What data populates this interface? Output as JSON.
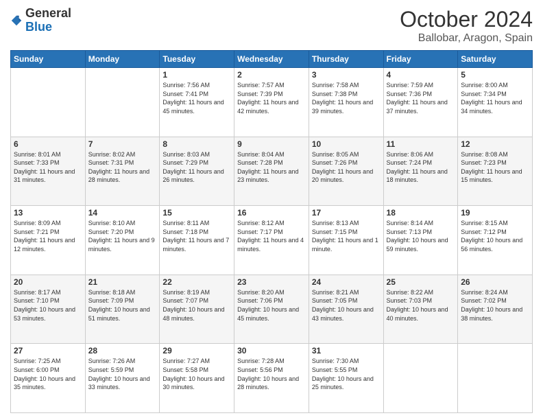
{
  "header": {
    "logo_general": "General",
    "logo_blue": "Blue",
    "month_title": "October 2024",
    "subtitle": "Ballobar, Aragon, Spain"
  },
  "days_of_week": [
    "Sunday",
    "Monday",
    "Tuesday",
    "Wednesday",
    "Thursday",
    "Friday",
    "Saturday"
  ],
  "weeks": [
    [
      {
        "day": "",
        "sunrise": "",
        "sunset": "",
        "daylight": ""
      },
      {
        "day": "",
        "sunrise": "",
        "sunset": "",
        "daylight": ""
      },
      {
        "day": "1",
        "sunrise": "Sunrise: 7:56 AM",
        "sunset": "Sunset: 7:41 PM",
        "daylight": "Daylight: 11 hours and 45 minutes."
      },
      {
        "day": "2",
        "sunrise": "Sunrise: 7:57 AM",
        "sunset": "Sunset: 7:39 PM",
        "daylight": "Daylight: 11 hours and 42 minutes."
      },
      {
        "day": "3",
        "sunrise": "Sunrise: 7:58 AM",
        "sunset": "Sunset: 7:38 PM",
        "daylight": "Daylight: 11 hours and 39 minutes."
      },
      {
        "day": "4",
        "sunrise": "Sunrise: 7:59 AM",
        "sunset": "Sunset: 7:36 PM",
        "daylight": "Daylight: 11 hours and 37 minutes."
      },
      {
        "day": "5",
        "sunrise": "Sunrise: 8:00 AM",
        "sunset": "Sunset: 7:34 PM",
        "daylight": "Daylight: 11 hours and 34 minutes."
      }
    ],
    [
      {
        "day": "6",
        "sunrise": "Sunrise: 8:01 AM",
        "sunset": "Sunset: 7:33 PM",
        "daylight": "Daylight: 11 hours and 31 minutes."
      },
      {
        "day": "7",
        "sunrise": "Sunrise: 8:02 AM",
        "sunset": "Sunset: 7:31 PM",
        "daylight": "Daylight: 11 hours and 28 minutes."
      },
      {
        "day": "8",
        "sunrise": "Sunrise: 8:03 AM",
        "sunset": "Sunset: 7:29 PM",
        "daylight": "Daylight: 11 hours and 26 minutes."
      },
      {
        "day": "9",
        "sunrise": "Sunrise: 8:04 AM",
        "sunset": "Sunset: 7:28 PM",
        "daylight": "Daylight: 11 hours and 23 minutes."
      },
      {
        "day": "10",
        "sunrise": "Sunrise: 8:05 AM",
        "sunset": "Sunset: 7:26 PM",
        "daylight": "Daylight: 11 hours and 20 minutes."
      },
      {
        "day": "11",
        "sunrise": "Sunrise: 8:06 AM",
        "sunset": "Sunset: 7:24 PM",
        "daylight": "Daylight: 11 hours and 18 minutes."
      },
      {
        "day": "12",
        "sunrise": "Sunrise: 8:08 AM",
        "sunset": "Sunset: 7:23 PM",
        "daylight": "Daylight: 11 hours and 15 minutes."
      }
    ],
    [
      {
        "day": "13",
        "sunrise": "Sunrise: 8:09 AM",
        "sunset": "Sunset: 7:21 PM",
        "daylight": "Daylight: 11 hours and 12 minutes."
      },
      {
        "day": "14",
        "sunrise": "Sunrise: 8:10 AM",
        "sunset": "Sunset: 7:20 PM",
        "daylight": "Daylight: 11 hours and 9 minutes."
      },
      {
        "day": "15",
        "sunrise": "Sunrise: 8:11 AM",
        "sunset": "Sunset: 7:18 PM",
        "daylight": "Daylight: 11 hours and 7 minutes."
      },
      {
        "day": "16",
        "sunrise": "Sunrise: 8:12 AM",
        "sunset": "Sunset: 7:17 PM",
        "daylight": "Daylight: 11 hours and 4 minutes."
      },
      {
        "day": "17",
        "sunrise": "Sunrise: 8:13 AM",
        "sunset": "Sunset: 7:15 PM",
        "daylight": "Daylight: 11 hours and 1 minute."
      },
      {
        "day": "18",
        "sunrise": "Sunrise: 8:14 AM",
        "sunset": "Sunset: 7:13 PM",
        "daylight": "Daylight: 10 hours and 59 minutes."
      },
      {
        "day": "19",
        "sunrise": "Sunrise: 8:15 AM",
        "sunset": "Sunset: 7:12 PM",
        "daylight": "Daylight: 10 hours and 56 minutes."
      }
    ],
    [
      {
        "day": "20",
        "sunrise": "Sunrise: 8:17 AM",
        "sunset": "Sunset: 7:10 PM",
        "daylight": "Daylight: 10 hours and 53 minutes."
      },
      {
        "day": "21",
        "sunrise": "Sunrise: 8:18 AM",
        "sunset": "Sunset: 7:09 PM",
        "daylight": "Daylight: 10 hours and 51 minutes."
      },
      {
        "day": "22",
        "sunrise": "Sunrise: 8:19 AM",
        "sunset": "Sunset: 7:07 PM",
        "daylight": "Daylight: 10 hours and 48 minutes."
      },
      {
        "day": "23",
        "sunrise": "Sunrise: 8:20 AM",
        "sunset": "Sunset: 7:06 PM",
        "daylight": "Daylight: 10 hours and 45 minutes."
      },
      {
        "day": "24",
        "sunrise": "Sunrise: 8:21 AM",
        "sunset": "Sunset: 7:05 PM",
        "daylight": "Daylight: 10 hours and 43 minutes."
      },
      {
        "day": "25",
        "sunrise": "Sunrise: 8:22 AM",
        "sunset": "Sunset: 7:03 PM",
        "daylight": "Daylight: 10 hours and 40 minutes."
      },
      {
        "day": "26",
        "sunrise": "Sunrise: 8:24 AM",
        "sunset": "Sunset: 7:02 PM",
        "daylight": "Daylight: 10 hours and 38 minutes."
      }
    ],
    [
      {
        "day": "27",
        "sunrise": "Sunrise: 7:25 AM",
        "sunset": "Sunset: 6:00 PM",
        "daylight": "Daylight: 10 hours and 35 minutes."
      },
      {
        "day": "28",
        "sunrise": "Sunrise: 7:26 AM",
        "sunset": "Sunset: 5:59 PM",
        "daylight": "Daylight: 10 hours and 33 minutes."
      },
      {
        "day": "29",
        "sunrise": "Sunrise: 7:27 AM",
        "sunset": "Sunset: 5:58 PM",
        "daylight": "Daylight: 10 hours and 30 minutes."
      },
      {
        "day": "30",
        "sunrise": "Sunrise: 7:28 AM",
        "sunset": "Sunset: 5:56 PM",
        "daylight": "Daylight: 10 hours and 28 minutes."
      },
      {
        "day": "31",
        "sunrise": "Sunrise: 7:30 AM",
        "sunset": "Sunset: 5:55 PM",
        "daylight": "Daylight: 10 hours and 25 minutes."
      },
      {
        "day": "",
        "sunrise": "",
        "sunset": "",
        "daylight": ""
      },
      {
        "day": "",
        "sunrise": "",
        "sunset": "",
        "daylight": ""
      }
    ]
  ]
}
